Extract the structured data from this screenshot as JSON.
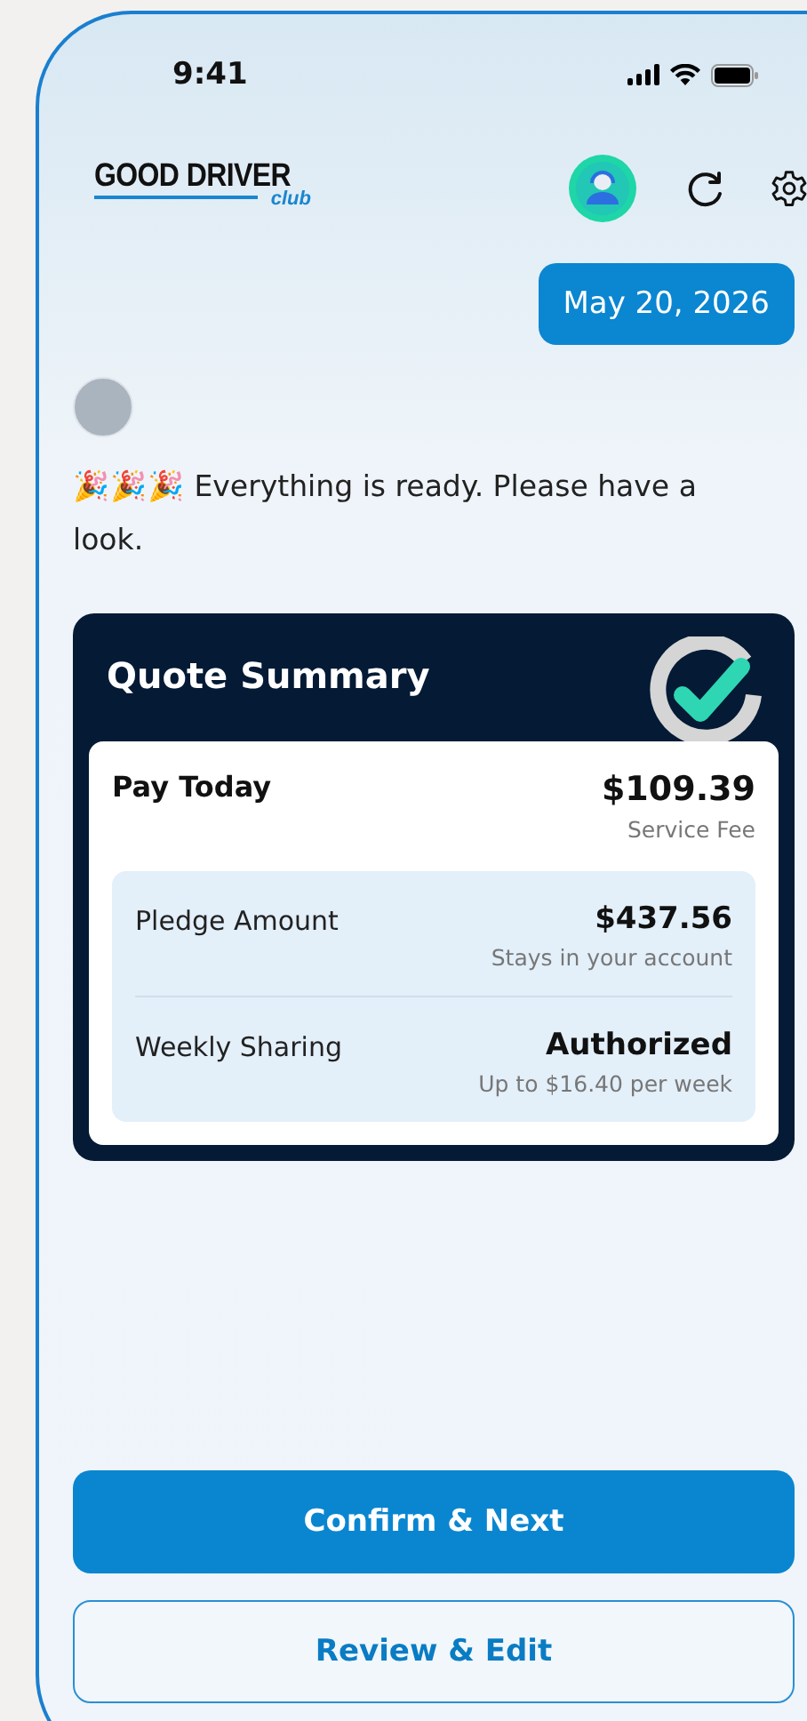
{
  "status_bar": {
    "time": "9:41"
  },
  "header": {
    "logo": {
      "title": "GOOD DRIVER",
      "subtitle": "club"
    }
  },
  "chat": {
    "date_bubble": "May 20, 2026",
    "message": "🎉🎉🎉 Everything is ready. Please have a look."
  },
  "quote_summary": {
    "title": "Quote Summary",
    "pay_today": {
      "label": "Pay Today",
      "amount": "$109.39",
      "note": "Service Fee"
    },
    "details": [
      {
        "label": "Pledge Amount",
        "value": "$437.56",
        "note": "Stays in your account"
      },
      {
        "label": "Weekly Sharing",
        "value": "Authorized",
        "note": "Up to $16.40 per week"
      }
    ]
  },
  "buttons": [
    {
      "label": "Confirm & Next",
      "kind": "primary"
    },
    {
      "label": "Review & Edit",
      "kind": "secondary"
    }
  ]
}
